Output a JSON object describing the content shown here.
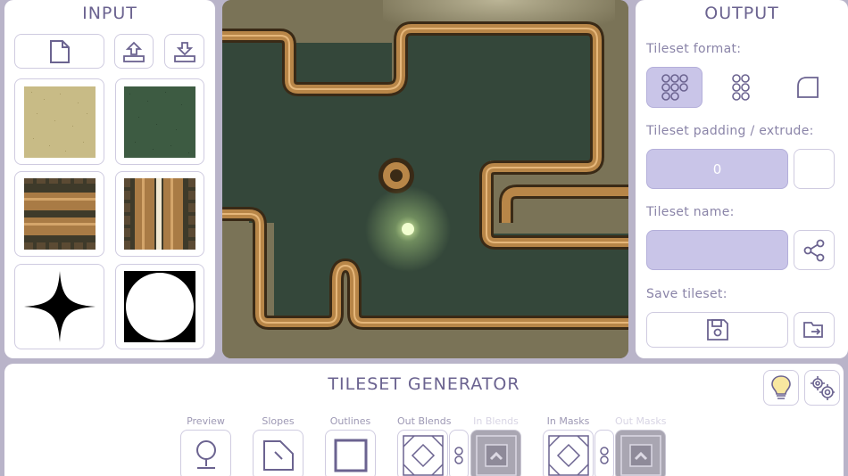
{
  "input": {
    "title": "INPUT",
    "buttons": {
      "new": "new-file",
      "import": "import",
      "export": "export"
    },
    "tiles": [
      "sand-texture",
      "grass-texture",
      "brick-horizontal",
      "brick-vertical",
      "star-shape",
      "circle-shape"
    ]
  },
  "output": {
    "title": "OUTPUT",
    "format_label": "Tileset format:",
    "padding_label": "Tileset padding / extrude:",
    "padding_value": "0",
    "name_label": "Tileset name:",
    "name_value": "",
    "save_label": "Save tileset:"
  },
  "generator": {
    "title": "TILESET GENERATOR",
    "tools": [
      {
        "label": "Preview"
      },
      {
        "label": "Slopes"
      },
      {
        "label": "Outlines"
      },
      {
        "label": "Out Blends"
      },
      {
        "label": "In Blends"
      },
      {
        "label": "In Masks"
      },
      {
        "label": "Out Masks"
      }
    ]
  },
  "colors": {
    "accent": "#6b6390",
    "field": "#c9c5e8",
    "sand": "#c8bb86",
    "grass": "#3d5b42",
    "wood": "#a97b45"
  }
}
